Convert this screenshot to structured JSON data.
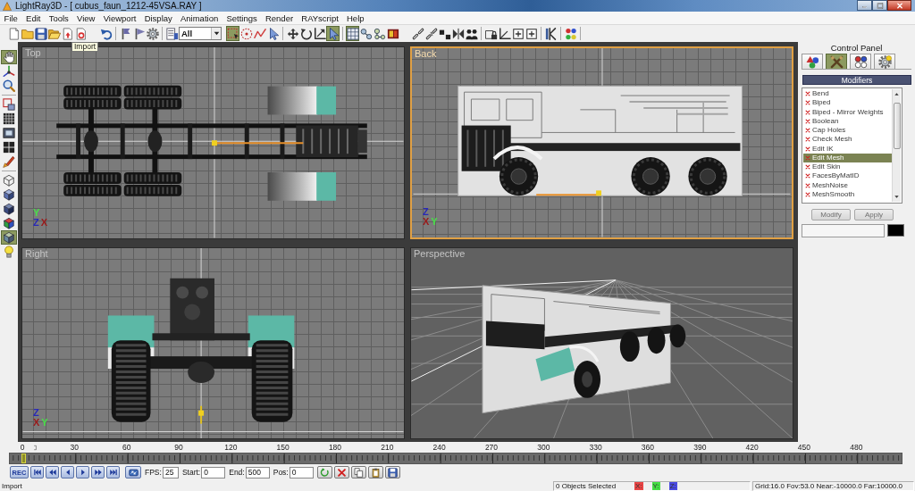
{
  "window": {
    "title": "LightRay3D - [ cubus_faun_1212-45VSA.RAY ]"
  },
  "menu": [
    "File",
    "Edit",
    "Tools",
    "View",
    "Viewport",
    "Display",
    "Animation",
    "Settings",
    "Render",
    "RAYscript",
    "Help"
  ],
  "toolbar": {
    "groups": [
      [
        {
          "kind": "button",
          "pressed": false
        },
        {
          "kind": "button",
          "pressed": false
        },
        {
          "kind": "button",
          "pressed": false
        },
        {
          "kind": "button",
          "pressed": false
        },
        {
          "kind": "button",
          "pressed": false
        },
        {
          "kind": "button",
          "pressed": false
        }
      ],
      [
        {
          "kind": "button",
          "pressed": false
        }
      ],
      [
        {
          "kind": "button",
          "pressed": false
        },
        {
          "kind": "button",
          "pressed": false
        },
        {
          "kind": "button",
          "pressed": false
        }
      ],
      [
        {
          "kind": "button",
          "pressed": false
        },
        {
          "kind": "dropdown",
          "value": "All"
        }
      ],
      [
        {
          "kind": "button",
          "pressed": true
        },
        {
          "kind": "button",
          "pressed": false
        },
        {
          "kind": "button",
          "pressed": false
        },
        {
          "kind": "button",
          "pressed": false
        }
      ],
      [
        {
          "kind": "button",
          "pressed": false
        },
        {
          "kind": "button",
          "pressed": false
        },
        {
          "kind": "button",
          "pressed": false
        },
        {
          "kind": "button",
          "pressed": true
        }
      ],
      [
        {
          "kind": "button",
          "pressed": true
        },
        {
          "kind": "button",
          "pressed": false
        },
        {
          "kind": "button",
          "pressed": false
        },
        {
          "kind": "button",
          "pressed": false
        }
      ],
      [
        {
          "kind": "button",
          "pressed": false
        },
        {
          "kind": "button",
          "pressed": false
        },
        {
          "kind": "button",
          "pressed": false
        },
        {
          "kind": "button",
          "pressed": false
        },
        {
          "kind": "button",
          "pressed": false
        }
      ],
      [
        {
          "kind": "button",
          "pressed": false
        },
        {
          "kind": "button",
          "pressed": false
        },
        {
          "kind": "button",
          "pressed": false
        },
        {
          "kind": "button",
          "pressed": false
        }
      ],
      [
        {
          "kind": "button",
          "pressed": false
        }
      ],
      [
        {
          "kind": "button",
          "pressed": false
        }
      ]
    ]
  },
  "tooltip": "Import",
  "side_toolbar": {
    "groups": [
      [
        {
          "pressed": true
        },
        {
          "pressed": false
        },
        {
          "pressed": false
        }
      ],
      [
        {
          "pressed": false
        },
        {
          "pressed": false
        },
        {
          "pressed": false
        },
        {
          "pressed": false
        },
        {
          "pressed": false
        }
      ],
      [
        {
          "pressed": false
        },
        {
          "pressed": false
        },
        {
          "pressed": false
        },
        {
          "pressed": false
        },
        {
          "pressed": true
        },
        {
          "pressed": false
        }
      ]
    ]
  },
  "viewports": [
    {
      "kind": "top",
      "label": "Top",
      "selected": false,
      "axes": [
        {
          "label": "Y",
          "color": "#48e048"
        },
        {
          "label": "Z",
          "color": "#2828b8"
        },
        {
          "label": "X",
          "color": "#9a1a1a"
        }
      ]
    },
    {
      "kind": "back",
      "label": "Back",
      "selected": true,
      "axes": [
        {
          "label": "Z",
          "color": "#2828b8"
        },
        {
          "label": "X",
          "color": "#9a1a1a"
        },
        {
          "label": "Y",
          "color": "#48e048"
        }
      ]
    },
    {
      "kind": "side",
      "label": "Right",
      "selected": false,
      "axes": [
        {
          "label": "Z",
          "color": "#2828b8"
        },
        {
          "label": "X",
          "color": "#9a1a1a"
        },
        {
          "label": "Y",
          "color": "#48e048"
        }
      ]
    },
    {
      "kind": "perspective",
      "label": "Perspective",
      "selected": false
    }
  ],
  "control_panel": {
    "title": "Control Panel",
    "tabs": [
      {
        "selected": false
      },
      {
        "selected": true
      },
      {
        "selected": false
      },
      {
        "selected": false
      }
    ],
    "section": "Modifiers",
    "modifiers": [
      {
        "label": "Bend",
        "selected": false
      },
      {
        "label": "Biped",
        "selected": false
      },
      {
        "label": "Biped - Mirror Weights",
        "selected": false
      },
      {
        "label": "Boolean",
        "selected": false
      },
      {
        "label": "Cap Holes",
        "selected": false
      },
      {
        "label": "Check Mesh",
        "selected": false
      },
      {
        "label": "Edit IK",
        "selected": false
      },
      {
        "label": "Edit Mesh",
        "selected": true
      },
      {
        "label": "Edit Skin",
        "selected": false
      },
      {
        "label": "FacesByMatID",
        "selected": false
      },
      {
        "label": "MeshNoise",
        "selected": false
      },
      {
        "label": "MeshSmooth",
        "selected": false
      }
    ],
    "buttons": [
      {
        "label": "Modify",
        "disabled": true
      },
      {
        "label": "Apply",
        "disabled": true
      }
    ],
    "color_swatch": {
      "color": "#000000"
    }
  },
  "timeline": {
    "ticks": [
      "0",
      "30",
      "60",
      "90",
      "120",
      "150",
      "180",
      "210",
      "240",
      "270",
      "300",
      "330",
      "360",
      "390",
      "420",
      "450",
      "480"
    ],
    "level": 0
  },
  "transport": {
    "record_label": "REC",
    "fields": [
      {
        "label": "FPS:",
        "value": "25"
      },
      {
        "label": "Start:",
        "value": "0"
      },
      {
        "label": "End:",
        "value": "500"
      },
      {
        "label": "Pos:",
        "value": "0"
      }
    ]
  },
  "status_bar": {
    "message": "Import",
    "selection": "0 Objects Selected",
    "axes": [
      {
        "label": "X:",
        "color": "#e84444"
      },
      {
        "label": "Y:",
        "color": "#44dd44"
      },
      {
        "label": "Z:",
        "color": "#4a4ae0"
      }
    ],
    "info": "Grid:16.0 Fov:53.0 Near:-10000.0 Far:10000.0"
  }
}
